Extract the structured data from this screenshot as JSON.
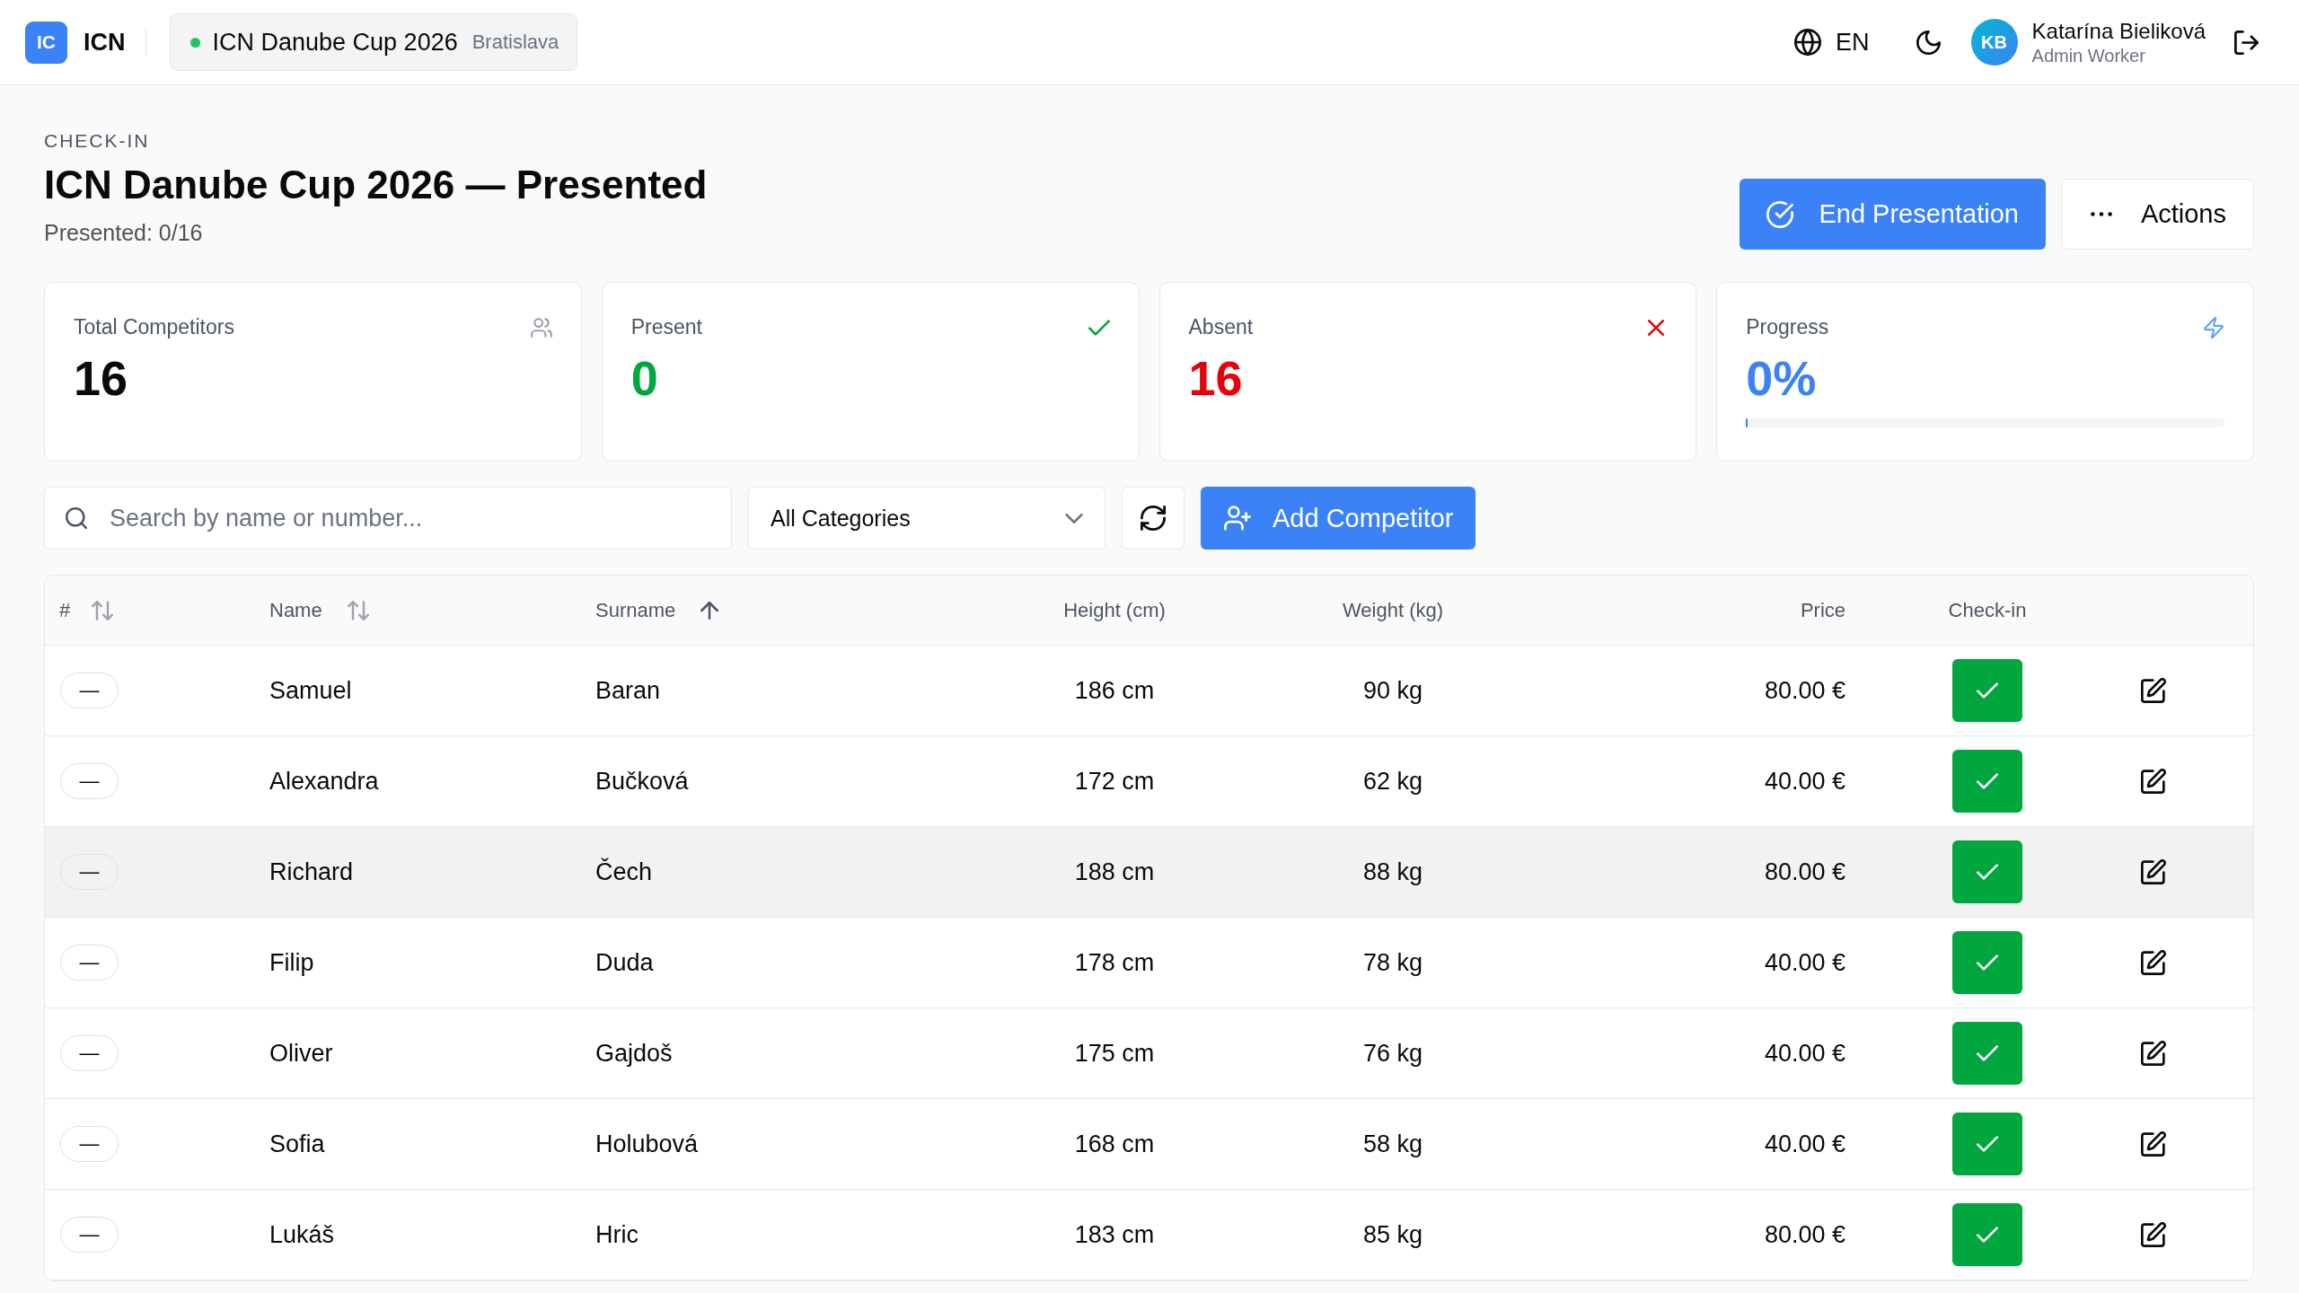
{
  "top_bar": {
    "logo": {
      "initials": "IC",
      "name": "ICN"
    },
    "event": {
      "name": "ICN Danube Cup 2026",
      "city": "Bratislava"
    },
    "language": "EN",
    "user": {
      "initials": "KB",
      "name": "Katarína Bieliková",
      "role": "Admin Worker"
    }
  },
  "page_header": {
    "eyebrow": "CHECK-IN",
    "title": "ICN Danube Cup 2026 — Presented",
    "subtitle": "Presented: 0/16"
  },
  "header_buttons": [
    {
      "kind": "primary",
      "label": "End Presentation"
    },
    {
      "kind": "menu",
      "label": "Actions"
    }
  ],
  "stats": [
    {
      "kind": "total",
      "label": "Total Competitors",
      "value": "16"
    },
    {
      "kind": "present",
      "label": "Present",
      "value": "0"
    },
    {
      "kind": "absent",
      "label": "Absent",
      "value": "16"
    },
    {
      "kind": "progress",
      "label": "Progress",
      "value": "0%",
      "level": 0
    }
  ],
  "toolbar": {
    "search": {
      "placeholder": "Search by name or number..."
    },
    "category": {
      "value": "All Categories"
    },
    "add_button": "Add Competitor"
  },
  "table": {
    "columns": [
      {
        "label": "#",
        "sorted": false
      },
      {
        "label": "Name",
        "sorted": false
      },
      {
        "label": "Surname",
        "sorted": true
      },
      {
        "label": "Height (cm)"
      },
      {
        "label": "Weight (kg)"
      },
      {
        "label": "Price"
      },
      {
        "label": "Check-in"
      }
    ],
    "rows": [
      {
        "number": "—",
        "name": "Samuel",
        "surname": "Baran",
        "height": "186 cm",
        "weight": "90 kg",
        "price": "80.00 €",
        "highlighted": false
      },
      {
        "number": "—",
        "name": "Alexandra",
        "surname": "Bučková",
        "height": "172 cm",
        "weight": "62 kg",
        "price": "40.00 €",
        "highlighted": false
      },
      {
        "number": "—",
        "name": "Richard",
        "surname": "Čech",
        "height": "188 cm",
        "weight": "88 kg",
        "price": "80.00 €",
        "highlighted": true
      },
      {
        "number": "—",
        "name": "Filip",
        "surname": "Duda",
        "height": "178 cm",
        "weight": "78 kg",
        "price": "40.00 €",
        "highlighted": false
      },
      {
        "number": "—",
        "name": "Oliver",
        "surname": "Gajdoš",
        "height": "175 cm",
        "weight": "76 kg",
        "price": "40.00 €",
        "highlighted": false
      },
      {
        "number": "—",
        "name": "Sofia",
        "surname": "Holubová",
        "height": "168 cm",
        "weight": "58 kg",
        "price": "40.00 €",
        "highlighted": false
      },
      {
        "number": "—",
        "name": "Lukáš",
        "surname": "Hric",
        "height": "183 cm",
        "weight": "85 kg",
        "price": "80.00 €",
        "highlighted": false
      }
    ]
  }
}
